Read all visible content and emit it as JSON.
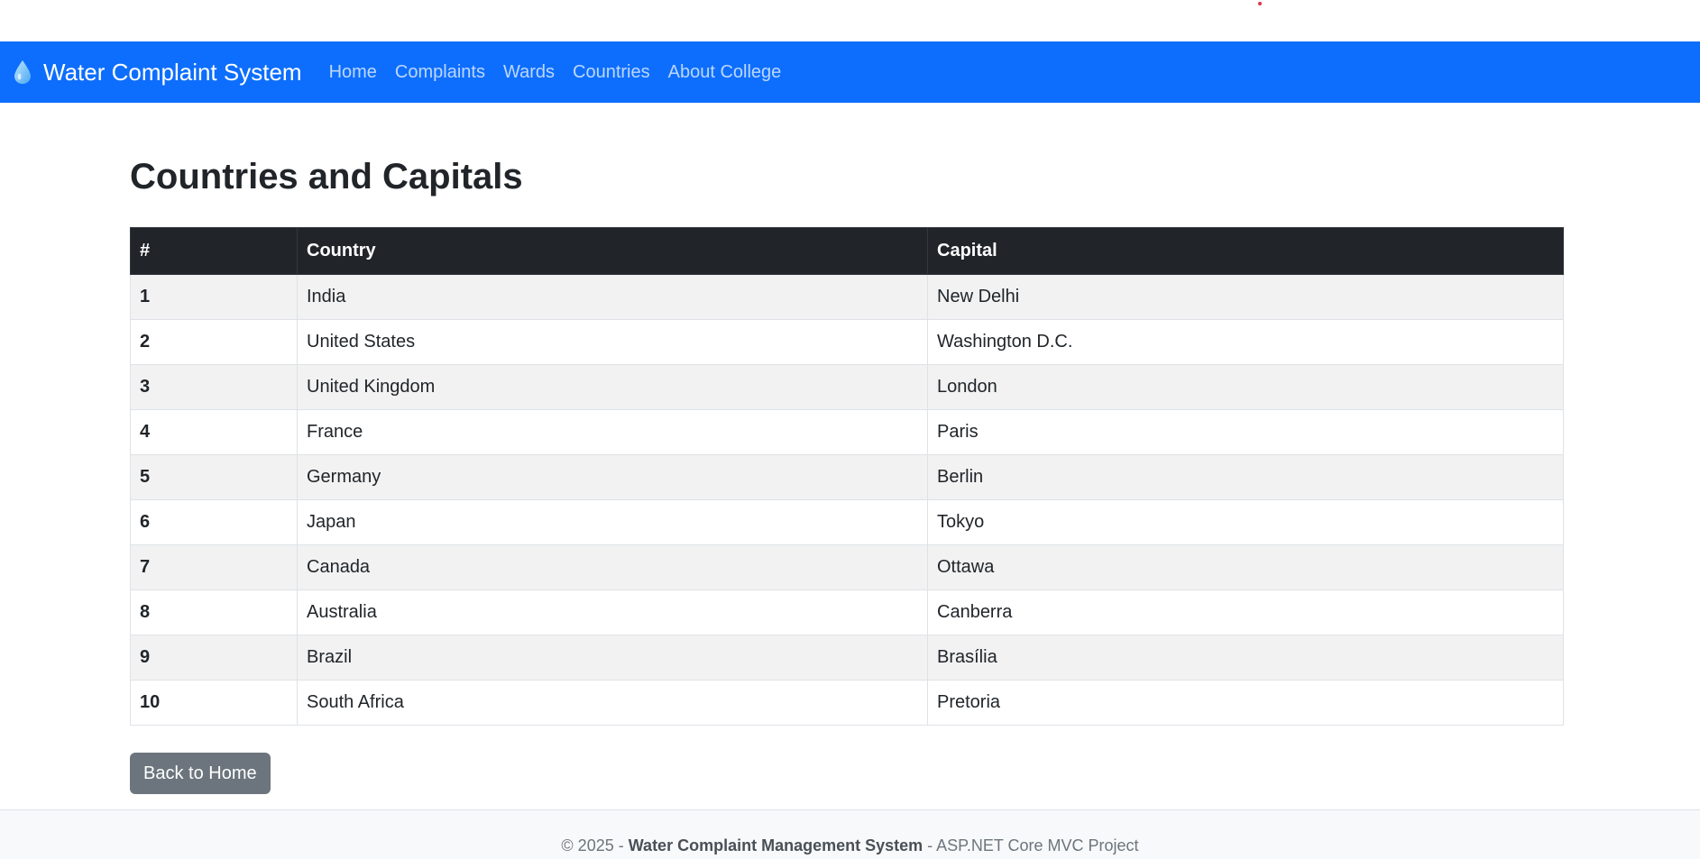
{
  "navbar": {
    "brand_icon": "water-drop-icon",
    "brand": "Water Complaint System",
    "links": [
      "Home",
      "Complaints",
      "Wards",
      "Countries",
      "About College"
    ],
    "color": "#0d6efd"
  },
  "main": {
    "title": "Countries and Capitals",
    "table": {
      "headers": [
        "#",
        "Country",
        "Capital"
      ],
      "rows": [
        {
          "num": "1",
          "country": "India",
          "capital": "New Delhi"
        },
        {
          "num": "2",
          "country": "United States",
          "capital": "Washington D.C."
        },
        {
          "num": "3",
          "country": "United Kingdom",
          "capital": "London"
        },
        {
          "num": "4",
          "country": "France",
          "capital": "Paris"
        },
        {
          "num": "5",
          "country": "Germany",
          "capital": "Berlin"
        },
        {
          "num": "6",
          "country": "Japan",
          "capital": "Tokyo"
        },
        {
          "num": "7",
          "country": "Canada",
          "capital": "Ottawa"
        },
        {
          "num": "8",
          "country": "Australia",
          "capital": "Canberra"
        },
        {
          "num": "9",
          "country": "Brazil",
          "capital": "Brasília"
        },
        {
          "num": "10",
          "country": "South Africa",
          "capital": "Pretoria"
        }
      ]
    },
    "back_button": "Back to Home"
  },
  "footer": {
    "prefix": "© 2025 - ",
    "name": "Water Complaint Management System",
    "suffix": " - ASP.NET Core MVC Project"
  }
}
